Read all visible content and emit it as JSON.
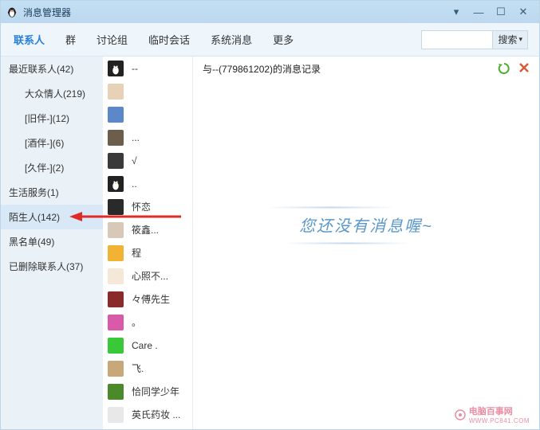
{
  "window": {
    "title": "消息管理器"
  },
  "tabs": [
    "联系人",
    "群",
    "讨论组",
    "临时会话",
    "系统消息",
    "更多"
  ],
  "activeTab": 0,
  "search": {
    "placeholder": "",
    "buttonLabel": "搜索"
  },
  "categories": [
    {
      "label": "最近联系人(42)",
      "indent": false,
      "selected": false
    },
    {
      "label": "大众情人(219)",
      "indent": true,
      "selected": false
    },
    {
      "label": "[旧伴-](12)",
      "indent": true,
      "selected": false
    },
    {
      "label": "[酒伴-](6)",
      "indent": true,
      "selected": false
    },
    {
      "label": "[久伴-](2)",
      "indent": true,
      "selected": false
    },
    {
      "label": "生活服务(1)",
      "indent": false,
      "selected": false
    },
    {
      "label": "陌生人(142)",
      "indent": false,
      "selected": true
    },
    {
      "label": "黑名单(49)",
      "indent": false,
      "selected": false
    },
    {
      "label": "已删除联系人(37)",
      "indent": false,
      "selected": false
    }
  ],
  "friends": [
    {
      "name": "--",
      "bg": "#222",
      "penguin": true
    },
    {
      "name": "",
      "bg": "#e7d2b8"
    },
    {
      "name": "",
      "bg": "#5a88c8"
    },
    {
      "name": "...",
      "bg": "#6b5e4a"
    },
    {
      "name": "√",
      "bg": "#3a3a3a"
    },
    {
      "name": "..",
      "bg": "#222",
      "penguin": true
    },
    {
      "name": "怀恋",
      "bg": "#2a2a2a"
    },
    {
      "name": "筱鑫...",
      "bg": "#d8c8b8"
    },
    {
      "name": "程",
      "bg": "#f2b233"
    },
    {
      "name": "心照不...",
      "bg": "#f5e8d8"
    },
    {
      "name": "々傅先生",
      "bg": "#8a2a2a"
    },
    {
      "name": "。",
      "bg": "#d85aa8"
    },
    {
      "name": "Care .",
      "bg": "#38c838"
    },
    {
      "name": "飞.",
      "bg": "#c8a878"
    },
    {
      "name": "恰同学少年",
      "bg": "#4a8a2a"
    },
    {
      "name": "英氏药妆 ...",
      "bg": "#e8e8e8"
    }
  ],
  "chat": {
    "header": "与--(779861202)的消息记录",
    "empty": "您还没有消息喔~"
  },
  "watermark": {
    "text": "电脑百事网",
    "url": "WWW.PC841.COM"
  }
}
